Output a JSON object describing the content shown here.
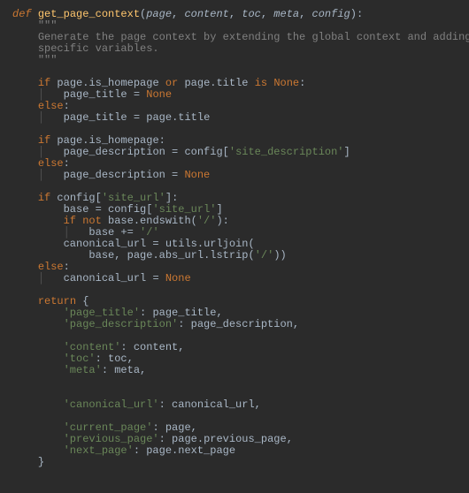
{
  "fn": {
    "def": "def",
    "name": "get_page_context",
    "params": [
      "page",
      "content",
      "toc",
      "meta",
      "config"
    ]
  },
  "doc": {
    "open": "\"\"\"",
    "l1": "Generate the page context by extending the global context and adding page",
    "l2": "specific variables.",
    "close": "\"\"\""
  },
  "kw": {
    "if": "if",
    "or": "or",
    "is": "is",
    "none": "None",
    "else": "else",
    "not": "not",
    "return": "return"
  },
  "tok": {
    "page": "page",
    "is_homepage": "is_homepage",
    "title": "title",
    "page_title": "page_title",
    "page_description": "page_description",
    "config": "config",
    "base": "base",
    "endswith": "endswith",
    "canonical_url": "canonical_url",
    "utils": "utils",
    "urljoin": "urljoin",
    "abs_url": "abs_url",
    "lstrip": "lstrip",
    "content": "content",
    "toc": "toc",
    "meta": "meta",
    "current_page": "current_page",
    "previous_page": "previous_page",
    "next_page": "next_page"
  },
  "str": {
    "site_description": "'site_description'",
    "site_url": "'site_url'",
    "slash": "'/'",
    "k_page_title": "'page_title'",
    "k_page_description": "'page_description'",
    "k_content": "'content'",
    "k_toc": "'toc'",
    "k_meta": "'meta'",
    "k_canonical_url": "'canonical_url'",
    "k_current_page": "'current_page'",
    "k_previous_page": "'previous_page'",
    "k_next_page": "'next_page'"
  },
  "punct": {
    "colon": ":",
    "comma": ", ",
    "lparen": "(",
    "rparen": ")",
    "dot": ".",
    "eq": " = ",
    "pluseq": " += ",
    "lbrace": "{",
    "rbrace": "}",
    "lbracket": "[",
    "rbracket": "]"
  },
  "guide": "│   "
}
